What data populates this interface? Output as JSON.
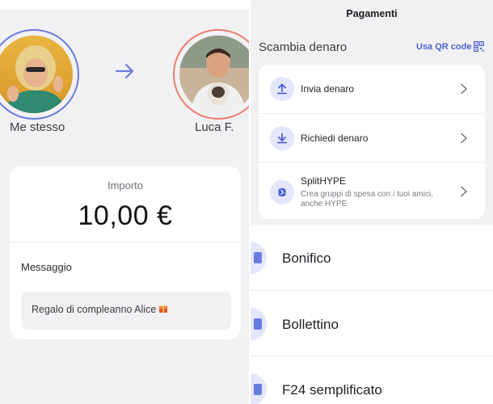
{
  "transfer": {
    "from_name": "Me stesso",
    "to_name": "Luca F.",
    "from_ring_color": "#6c7ce0",
    "to_ring_color": "#ef7d6b"
  },
  "amount": {
    "label": "Importo",
    "value": "10,00 €"
  },
  "message": {
    "label": "Messaggio",
    "text": "Regalo di compleanno Alice"
  },
  "payments": {
    "header_title": "Pagamenti",
    "section_title": "Scambia denaro",
    "qr_link": "Usa QR code",
    "exchange_items": [
      {
        "label": "Invia denaro",
        "icon": "upload-icon"
      },
      {
        "label": "Richiedi denaro",
        "icon": "download-icon"
      },
      {
        "label": "SplitHYPE",
        "subtitle_line1": "Crea gruppi di spesa con i tuoi amici,",
        "subtitle_line2": "anche HYPE",
        "icon": "split-icon"
      }
    ],
    "list_items": [
      {
        "label": "Bonifico"
      },
      {
        "label": "Bollettino"
      },
      {
        "label": "F24 semplificato"
      }
    ],
    "accent": "#4a5fd6"
  }
}
